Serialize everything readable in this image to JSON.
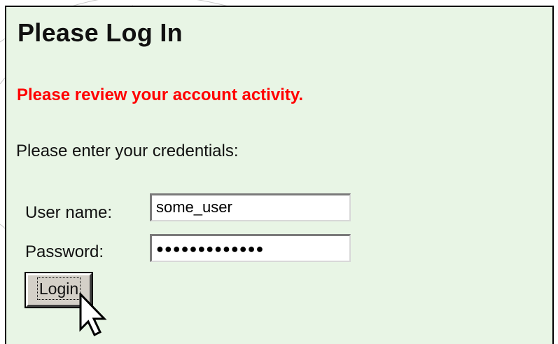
{
  "page": {
    "title": "Please Log In",
    "alert_message": "Please review your account activity.",
    "instruction": "Please enter your credentials:",
    "accent_color": "#ff0000",
    "background_color": "#e8f5e5"
  },
  "form": {
    "username": {
      "label": "User name:",
      "value": "some_user"
    },
    "password": {
      "label": "Password:",
      "masked_value": "●●●●●●●●●●●●●"
    },
    "login_button_label": "Login"
  },
  "icons": {
    "cursor": "mouse-pointer-arrow-icon"
  }
}
